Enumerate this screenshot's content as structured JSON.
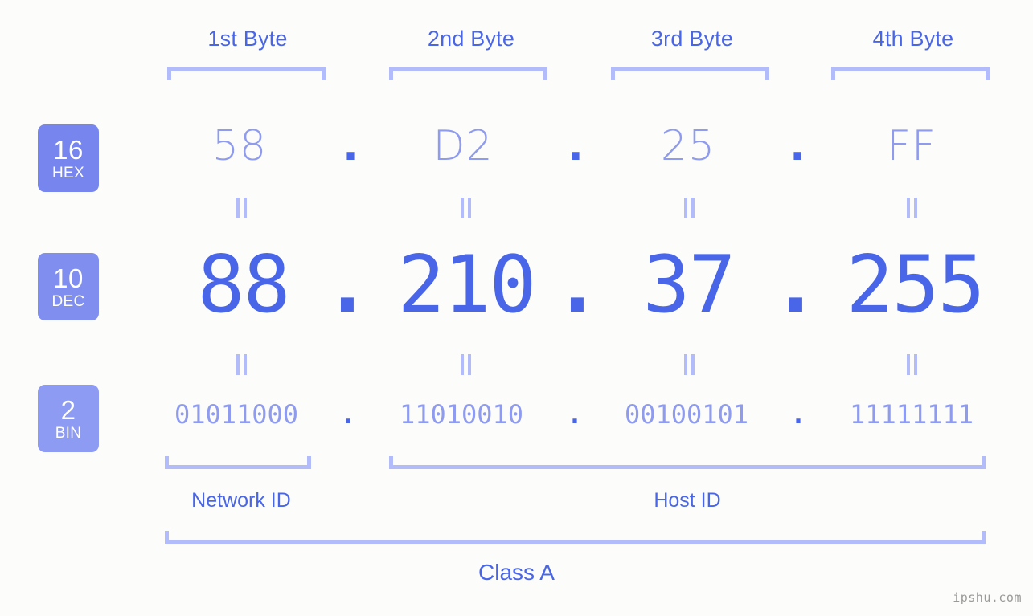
{
  "background": "#fcfdfa",
  "accent_strong": "#4a66e8",
  "accent_light": "#8e9bee",
  "bracket_color": "#b3bcfb",
  "byte_headers": [
    {
      "label": "1st Byte"
    },
    {
      "label": "2nd Byte"
    },
    {
      "label": "3rd Byte"
    },
    {
      "label": "4th Byte"
    }
  ],
  "bases": [
    {
      "number": "16",
      "name": "HEX",
      "color": "#7686ee"
    },
    {
      "number": "10",
      "name": "DEC",
      "color": "#808fef"
    },
    {
      "number": "2",
      "name": "BIN",
      "color": "#8d9bf3"
    }
  ],
  "rows": {
    "hex": {
      "values": [
        "58",
        "D2",
        "25",
        "FF"
      ],
      "separator": "."
    },
    "dec": {
      "values": [
        "88",
        "210",
        "37",
        "255"
      ],
      "separator": "."
    },
    "bin": {
      "values": [
        "01011000",
        "11010010",
        "00100101",
        "11111111"
      ],
      "separator": "."
    }
  },
  "equality_symbol": "=",
  "segments": {
    "network_id": "Network ID",
    "host_id": "Host ID"
  },
  "class_label": "Class A",
  "watermark": "ipshu.com"
}
